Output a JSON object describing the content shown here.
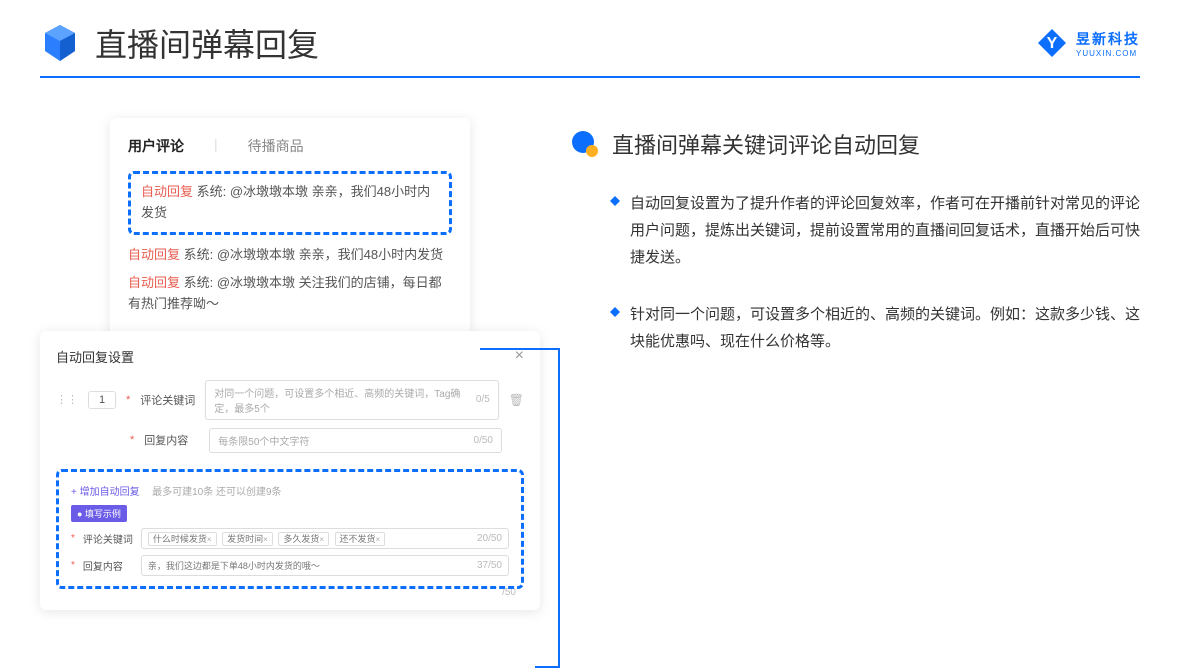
{
  "header": {
    "title": "直播间弹幕回复",
    "logo_cn": "昱新科技",
    "logo_en": "YUUXIN.COM"
  },
  "card1": {
    "tab_active": "用户评论",
    "tab_inactive": "待播商品",
    "highlighted": {
      "tag": "自动回复",
      "text": "系统: @冰墩墩本墩 亲亲，我们48小时内发货"
    },
    "rows": [
      {
        "tag": "自动回复",
        "text": "系统: @冰墩墩本墩 亲亲，我们48小时内发货"
      },
      {
        "tag": "自动回复",
        "text": "系统: @冰墩墩本墩 关注我们的店铺，每日都有热门推荐呦～"
      }
    ]
  },
  "card2": {
    "title": "自动回复设置",
    "num": "1",
    "kw_label": "评论关键词",
    "kw_placeholder": "对同一个问题，可设置多个相近、高频的关键词，Tag确定，最多5个",
    "kw_count": "0/5",
    "content_label": "回复内容",
    "content_placeholder": "每条限50个中文字符",
    "content_count": "0/50",
    "add_link": "+ 增加自动回复",
    "add_hint": "最多可建10条 还可以创建9条",
    "example_tag": "● 填写示例",
    "ex_kw_label": "评论关键词",
    "ex_tags": [
      "什么时候发货",
      "发货时间",
      "多久发货",
      "还不发货"
    ],
    "ex_kw_count": "20/50",
    "ex_content_label": "回复内容",
    "ex_content_text": "亲，我们这边都是下单48小时内发货的哦～",
    "ex_content_count": "37/50",
    "below_count": "/50"
  },
  "right": {
    "section_title": "直播间弹幕关键词评论自动回复",
    "bullets": [
      "自动回复设置为了提升作者的评论回复效率，作者可在开播前针对常见的评论用户问题，提炼出关键词，提前设置常用的直播间回复话术，直播开始后可快捷发送。",
      "针对同一个问题，可设置多个相近的、高频的关键词。例如：这款多少钱、这块能优惠吗、现在什么价格等。"
    ]
  }
}
